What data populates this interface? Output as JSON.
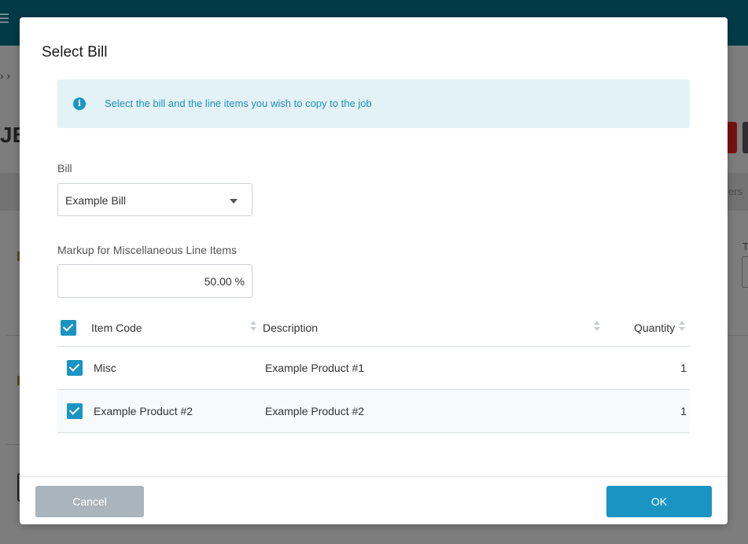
{
  "background": {
    "breadcrumb_sep": "› ›",
    "title_fragment": "JB",
    "tab_fragment": "ers",
    "col_fragment": "T",
    "col_fragment2": "t"
  },
  "modal": {
    "title": "Select Bill",
    "info_icon": "info-icon",
    "info_text": "Select the bill and the line items you wish to copy to the job",
    "bill_label": "Bill",
    "bill_value": "Example Bill",
    "markup_label": "Markup for Miscellaneous Line Items",
    "markup_value": "50.00 %",
    "table": {
      "headers": {
        "item_code": "Item Code",
        "description": "Description",
        "quantity": "Quantity"
      },
      "rows": [
        {
          "item_code": "Misc",
          "description": "Example Product #1",
          "quantity": "1",
          "checked": true
        },
        {
          "item_code": "Example Product #2",
          "description": "Example Product #2",
          "quantity": "1",
          "checked": true
        }
      ]
    },
    "cancel_label": "Cancel",
    "ok_label": "OK"
  },
  "colors": {
    "accent": "#1a94c2",
    "topbar": "#033a47",
    "info_bg": "#e3f2f7",
    "cancel_bg": "#a9b4bc"
  }
}
